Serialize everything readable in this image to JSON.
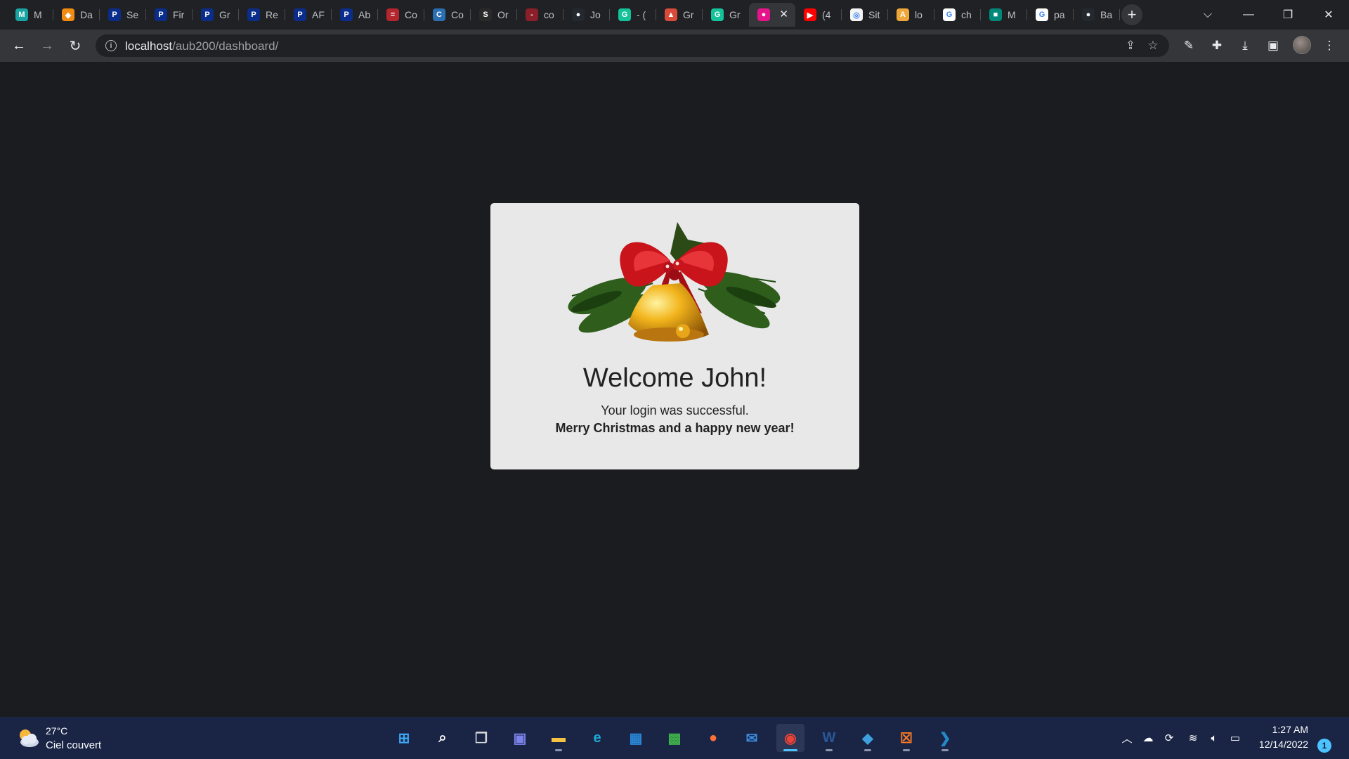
{
  "browser": {
    "tabs": [
      {
        "title": "M",
        "icon": "meistertask-icon",
        "color": "#1aa3a3",
        "glyph": "M"
      },
      {
        "title": "Da",
        "icon": "flame-icon",
        "color": "#f28b12",
        "glyph": "◆"
      },
      {
        "title": "Se",
        "icon": "p-icon",
        "color": "#0a2d8c",
        "glyph": "P"
      },
      {
        "title": "Fir",
        "icon": "p-icon",
        "color": "#0a2d8c",
        "glyph": "P"
      },
      {
        "title": "Gr",
        "icon": "p-icon",
        "color": "#0a2d8c",
        "glyph": "P"
      },
      {
        "title": "Re",
        "icon": "p-icon",
        "color": "#0a2d8c",
        "glyph": "P"
      },
      {
        "title": "AF",
        "icon": "p-icon",
        "color": "#0a2d8c",
        "glyph": "P"
      },
      {
        "title": "Ab",
        "icon": "p-icon",
        "color": "#0a2d8c",
        "glyph": "P"
      },
      {
        "title": "Co",
        "icon": "flag-icon",
        "color": "#b3262d",
        "glyph": "="
      },
      {
        "title": "Co",
        "icon": "circle-arrow-icon",
        "color": "#2b6fb3",
        "glyph": "C"
      },
      {
        "title": "Or",
        "icon": "s-icon",
        "color": "#2a2a2a",
        "glyph": "S"
      },
      {
        "title": "co",
        "icon": "flag-icon",
        "color": "#8a1f2a",
        "glyph": "-"
      },
      {
        "title": "Jo",
        "icon": "github-icon",
        "color": "#24292f",
        "glyph": "●"
      },
      {
        "title": "- (",
        "icon": "grammarly-icon",
        "color": "#15c39a",
        "glyph": "G"
      },
      {
        "title": "Gr",
        "icon": "store-icon",
        "color": "#d84a3a",
        "glyph": "▲"
      },
      {
        "title": "Gr",
        "icon": "grammarly-icon",
        "color": "#15c39a",
        "glyph": "G"
      },
      {
        "title": "",
        "icon": "pink-app-icon",
        "color": "#e5148a",
        "glyph": "●"
      },
      {
        "title": "(4",
        "icon": "youtube-icon",
        "color": "#ff0000",
        "glyph": "▶"
      },
      {
        "title": "Sit",
        "icon": "record-icon",
        "color": "#f4f4f4",
        "glyph": "◎"
      },
      {
        "title": "lo",
        "icon": "paint-icon",
        "color": "#f0a73a",
        "glyph": "A"
      },
      {
        "title": "ch",
        "icon": "google-icon",
        "color": "#ffffff",
        "glyph": "G"
      },
      {
        "title": "M",
        "icon": "meet-icon",
        "color": "#00897b",
        "glyph": "■"
      },
      {
        "title": "pa",
        "icon": "google-icon",
        "color": "#ffffff",
        "glyph": "G"
      },
      {
        "title": "Ba",
        "icon": "github-icon",
        "color": "#24292f",
        "glyph": "●"
      }
    ],
    "active_tab_index": 16,
    "address": {
      "host": "localhost",
      "path": "/aub200/dashboard/"
    }
  },
  "page": {
    "heading": "Welcome John!",
    "message_line1": "Your login was successful.",
    "message_line2": "Merry Christmas and a happy new year!"
  },
  "taskbar": {
    "weather": {
      "temp": "27°C",
      "condition": "Ciel couvert"
    },
    "apps": [
      {
        "name": "start-button",
        "glyph": "⊞",
        "color": "#3ea6f2"
      },
      {
        "name": "search-button",
        "glyph": "⌕",
        "color": "#ffffff"
      },
      {
        "name": "task-view-button",
        "glyph": "❐",
        "color": "#d9d9d9"
      },
      {
        "name": "chat-button",
        "glyph": "▣",
        "color": "#7b83eb"
      },
      {
        "name": "file-explorer-button",
        "glyph": "▬",
        "color": "#f5c342"
      },
      {
        "name": "edge-button",
        "glyph": "e",
        "color": "#1fa9d6"
      },
      {
        "name": "store-button",
        "glyph": "▦",
        "color": "#2a86d6"
      },
      {
        "name": "gamepass-button",
        "glyph": "▩",
        "color": "#3fb24a"
      },
      {
        "name": "firefox-button",
        "glyph": "●",
        "color": "#ff7139"
      },
      {
        "name": "mail-button",
        "glyph": "✉",
        "color": "#3c8ee0"
      },
      {
        "name": "chrome-button",
        "glyph": "◉",
        "color": "#ea4335"
      },
      {
        "name": "word-button",
        "glyph": "W",
        "color": "#2b579a"
      },
      {
        "name": "git-button",
        "glyph": "◆",
        "color": "#3fa0e0"
      },
      {
        "name": "xampp-button",
        "glyph": "☒",
        "color": "#fb7a24"
      },
      {
        "name": "vscode-button",
        "glyph": "❯",
        "color": "#2489ca"
      }
    ],
    "active_app": "chrome-button",
    "running_apps": [
      "file-explorer-button",
      "chrome-button",
      "word-button",
      "git-button",
      "xampp-button",
      "vscode-button"
    ],
    "clock": {
      "time": "1:27 AM",
      "date": "12/14/2022"
    },
    "notification_count": "1"
  }
}
